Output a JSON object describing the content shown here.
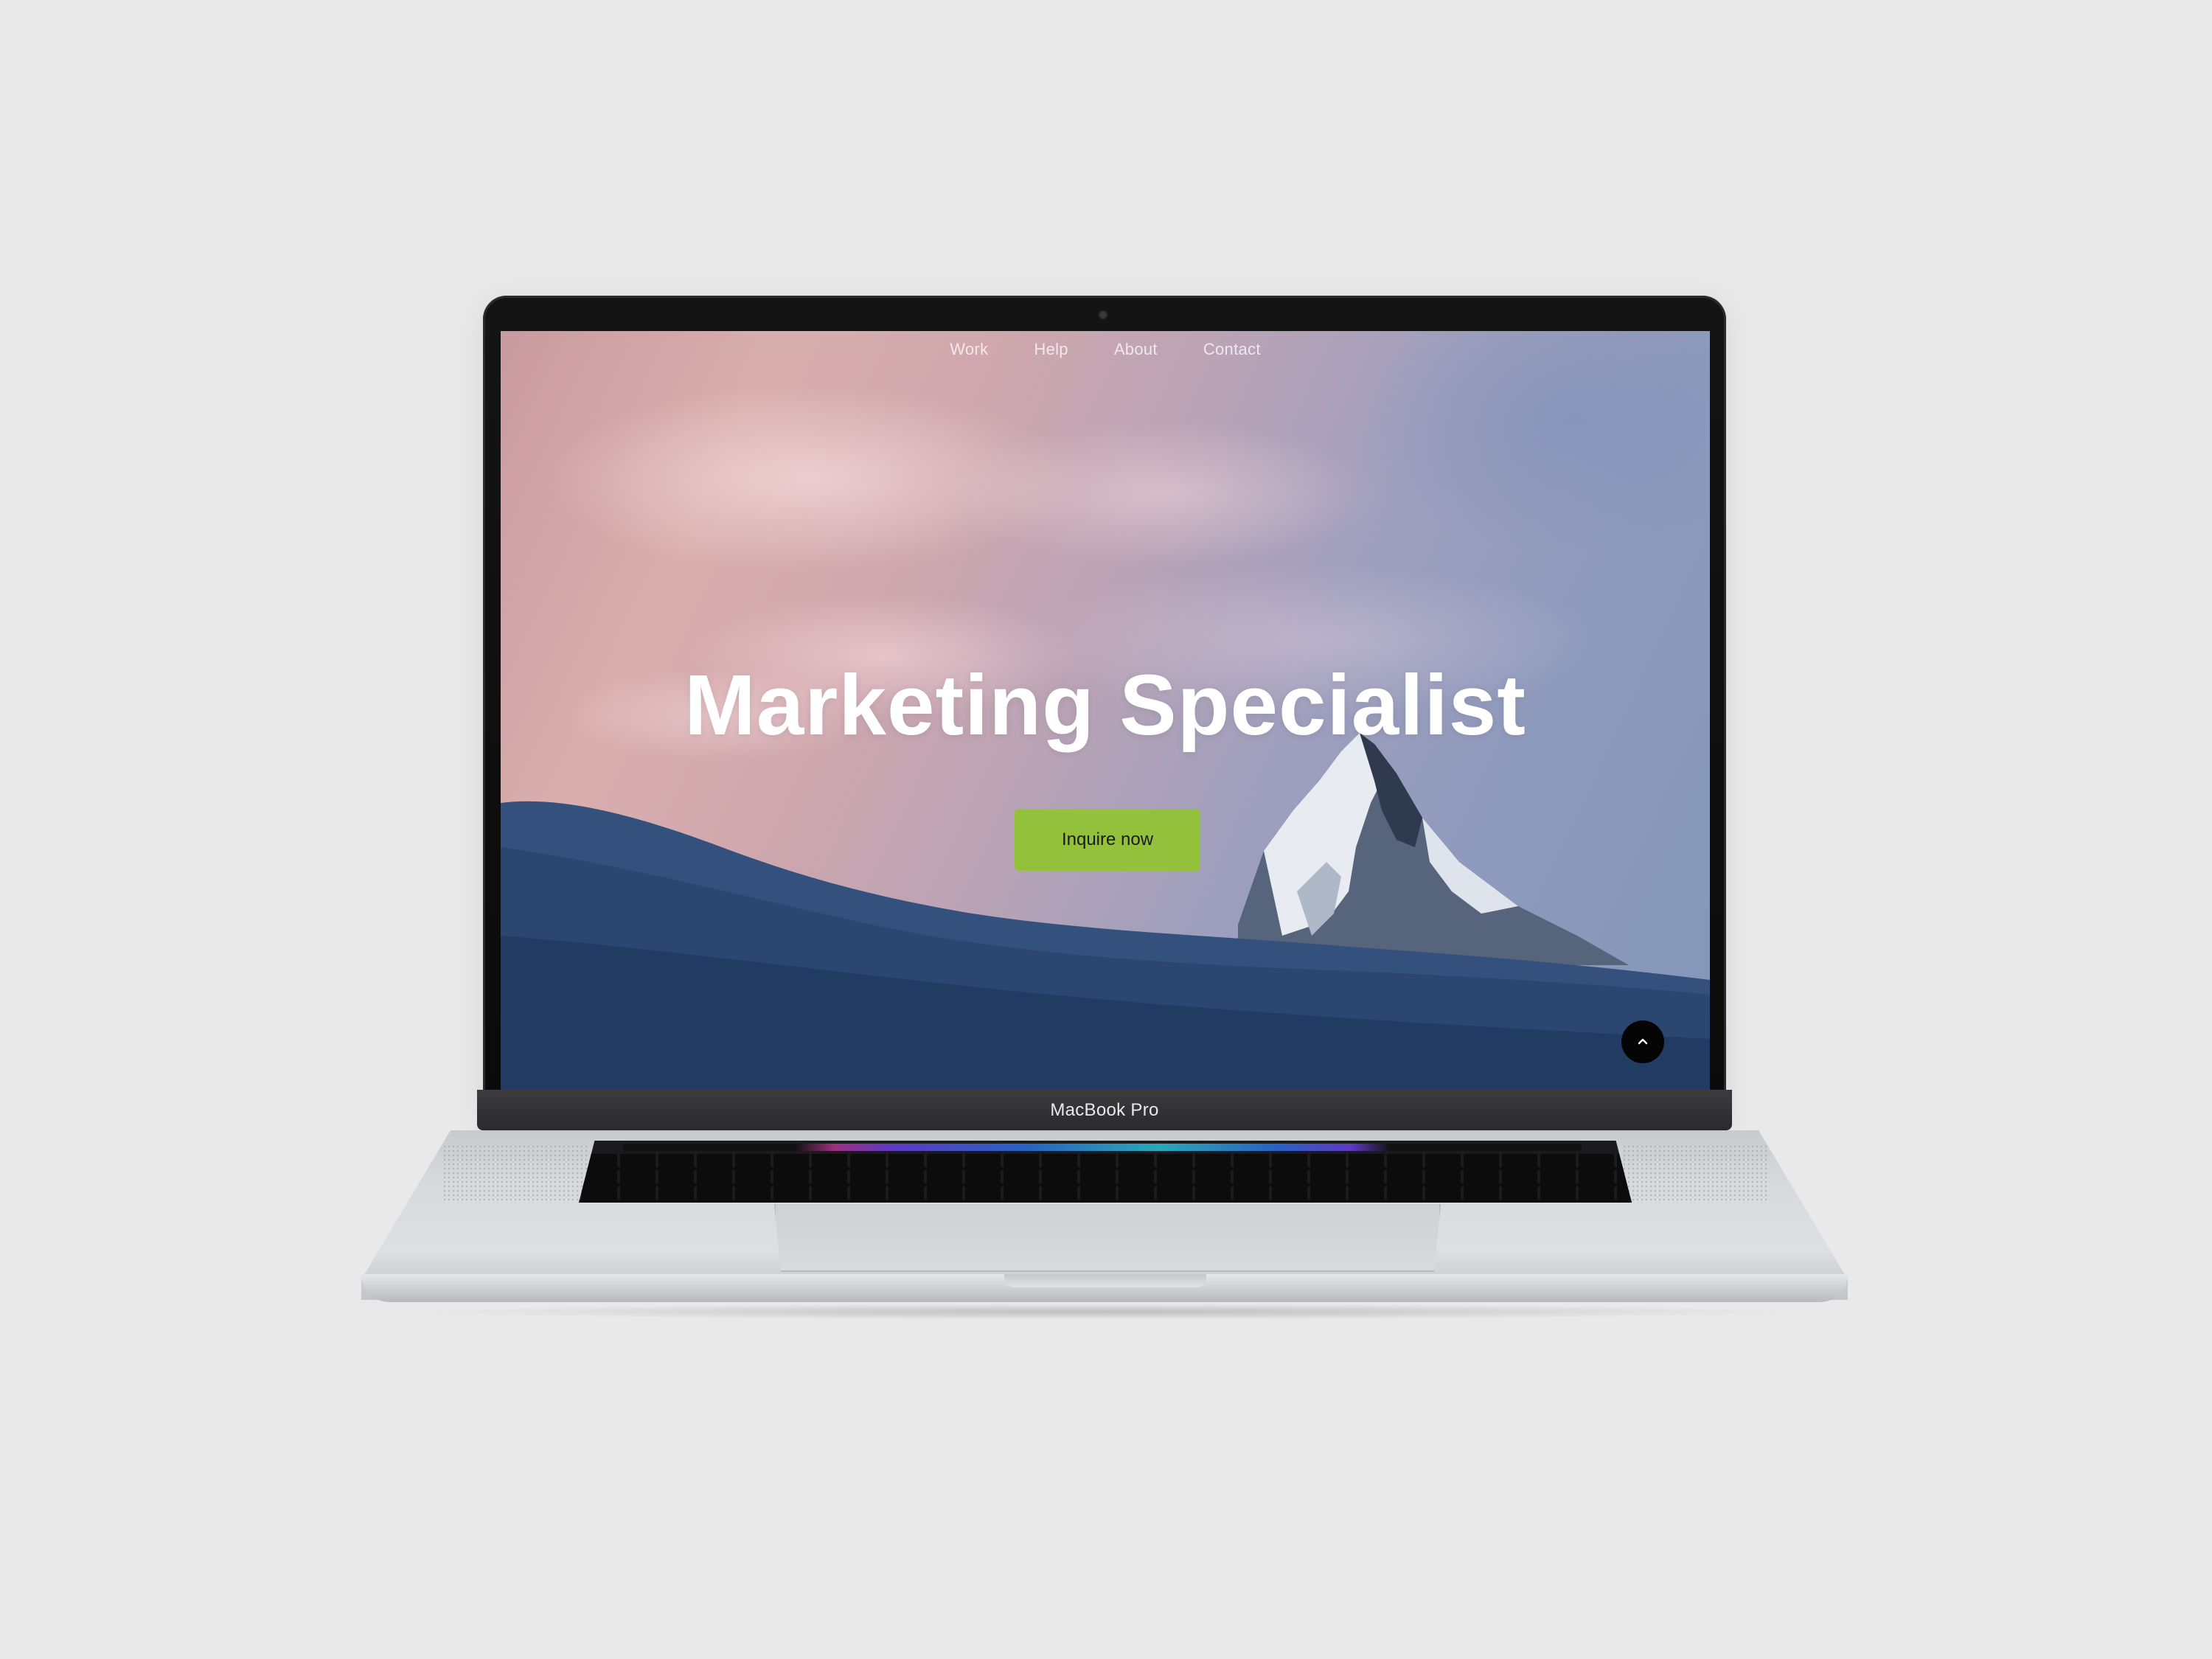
{
  "website": {
    "nav": [
      "Work",
      "Help",
      "About",
      "Contact"
    ],
    "hero_title": "Marketing Specialist",
    "cta_label": "Inquire now",
    "scroll_top_icon": "chevron-up-icon",
    "colors": {
      "cta_background": "#94c13b",
      "hero_text": "#ffffff",
      "scroll_top_background": "#050505"
    }
  },
  "device": {
    "brand_label": "MacBook Pro"
  }
}
